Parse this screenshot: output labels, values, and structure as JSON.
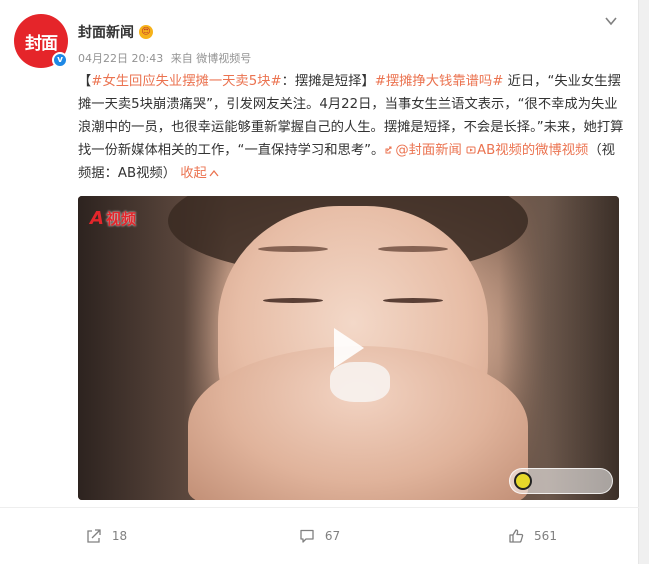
{
  "account": {
    "avatar_text": "封面",
    "name": "封面新闻",
    "verified_mark": "v",
    "badge_emoji": "😍"
  },
  "meta": {
    "date": "04月22日 20:43",
    "source": "来自 微博视频号"
  },
  "post": {
    "open_bracket": "【",
    "topic1": "#女生回应失业摆摊一天卖5块#",
    "headline_tail": "：摆摊是短择】",
    "topic2": "#摆摊挣大钱靠谱吗#",
    "body": " 近日，“失业女生摆摊一天卖5块崩溃痛哭”，引发网友关注。4月22日，当事女生兰语文表示，“很不幸成为失业浪潮中的一员，也很幸运能够重新掌握自己的人生。摆摊是短择，不会是长择。”未来，她打算找一份新媒体相关的工作，“一直保持学习和思考”。",
    "mention": "@封面新闻",
    "video_link": "AB视频的微博视频",
    "video_credit": "（视频据：AB视频）",
    "collapse_label": "收起"
  },
  "video": {
    "logo_letter": "A",
    "logo_text": "视频"
  },
  "actions": {
    "share_count": "18",
    "comment_count": "67",
    "like_count": "561"
  },
  "colors": {
    "link": "#eb7350",
    "brand_red": "#e5252a",
    "verified_blue": "#1e88e5"
  }
}
